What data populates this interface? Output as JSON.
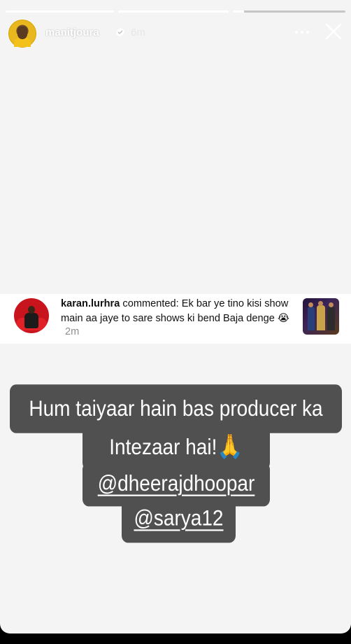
{
  "story": {
    "progress": [
      1.0,
      1.0,
      0.1
    ],
    "username": "manitjoura",
    "time": "6m",
    "verified": true
  },
  "comment": {
    "username": "karan.lurhra",
    "action": "commented:",
    "text": "Ek bar ye tino kisi show main aa jaye to sare shows ki bend Baja denge",
    "emoji": "😭",
    "time": "2m"
  },
  "caption": {
    "line1": "Hum taiyaar hain bas producer ka",
    "line2_text": "Intezaar hai!",
    "line2_emoji": "🙏",
    "mention1": "@dheerajdhoopar",
    "mention2": "@sarya12"
  },
  "colors": {
    "story_bg": "#f4f4f4",
    "caption_bg": "#505050",
    "verified": "#ffffff"
  }
}
